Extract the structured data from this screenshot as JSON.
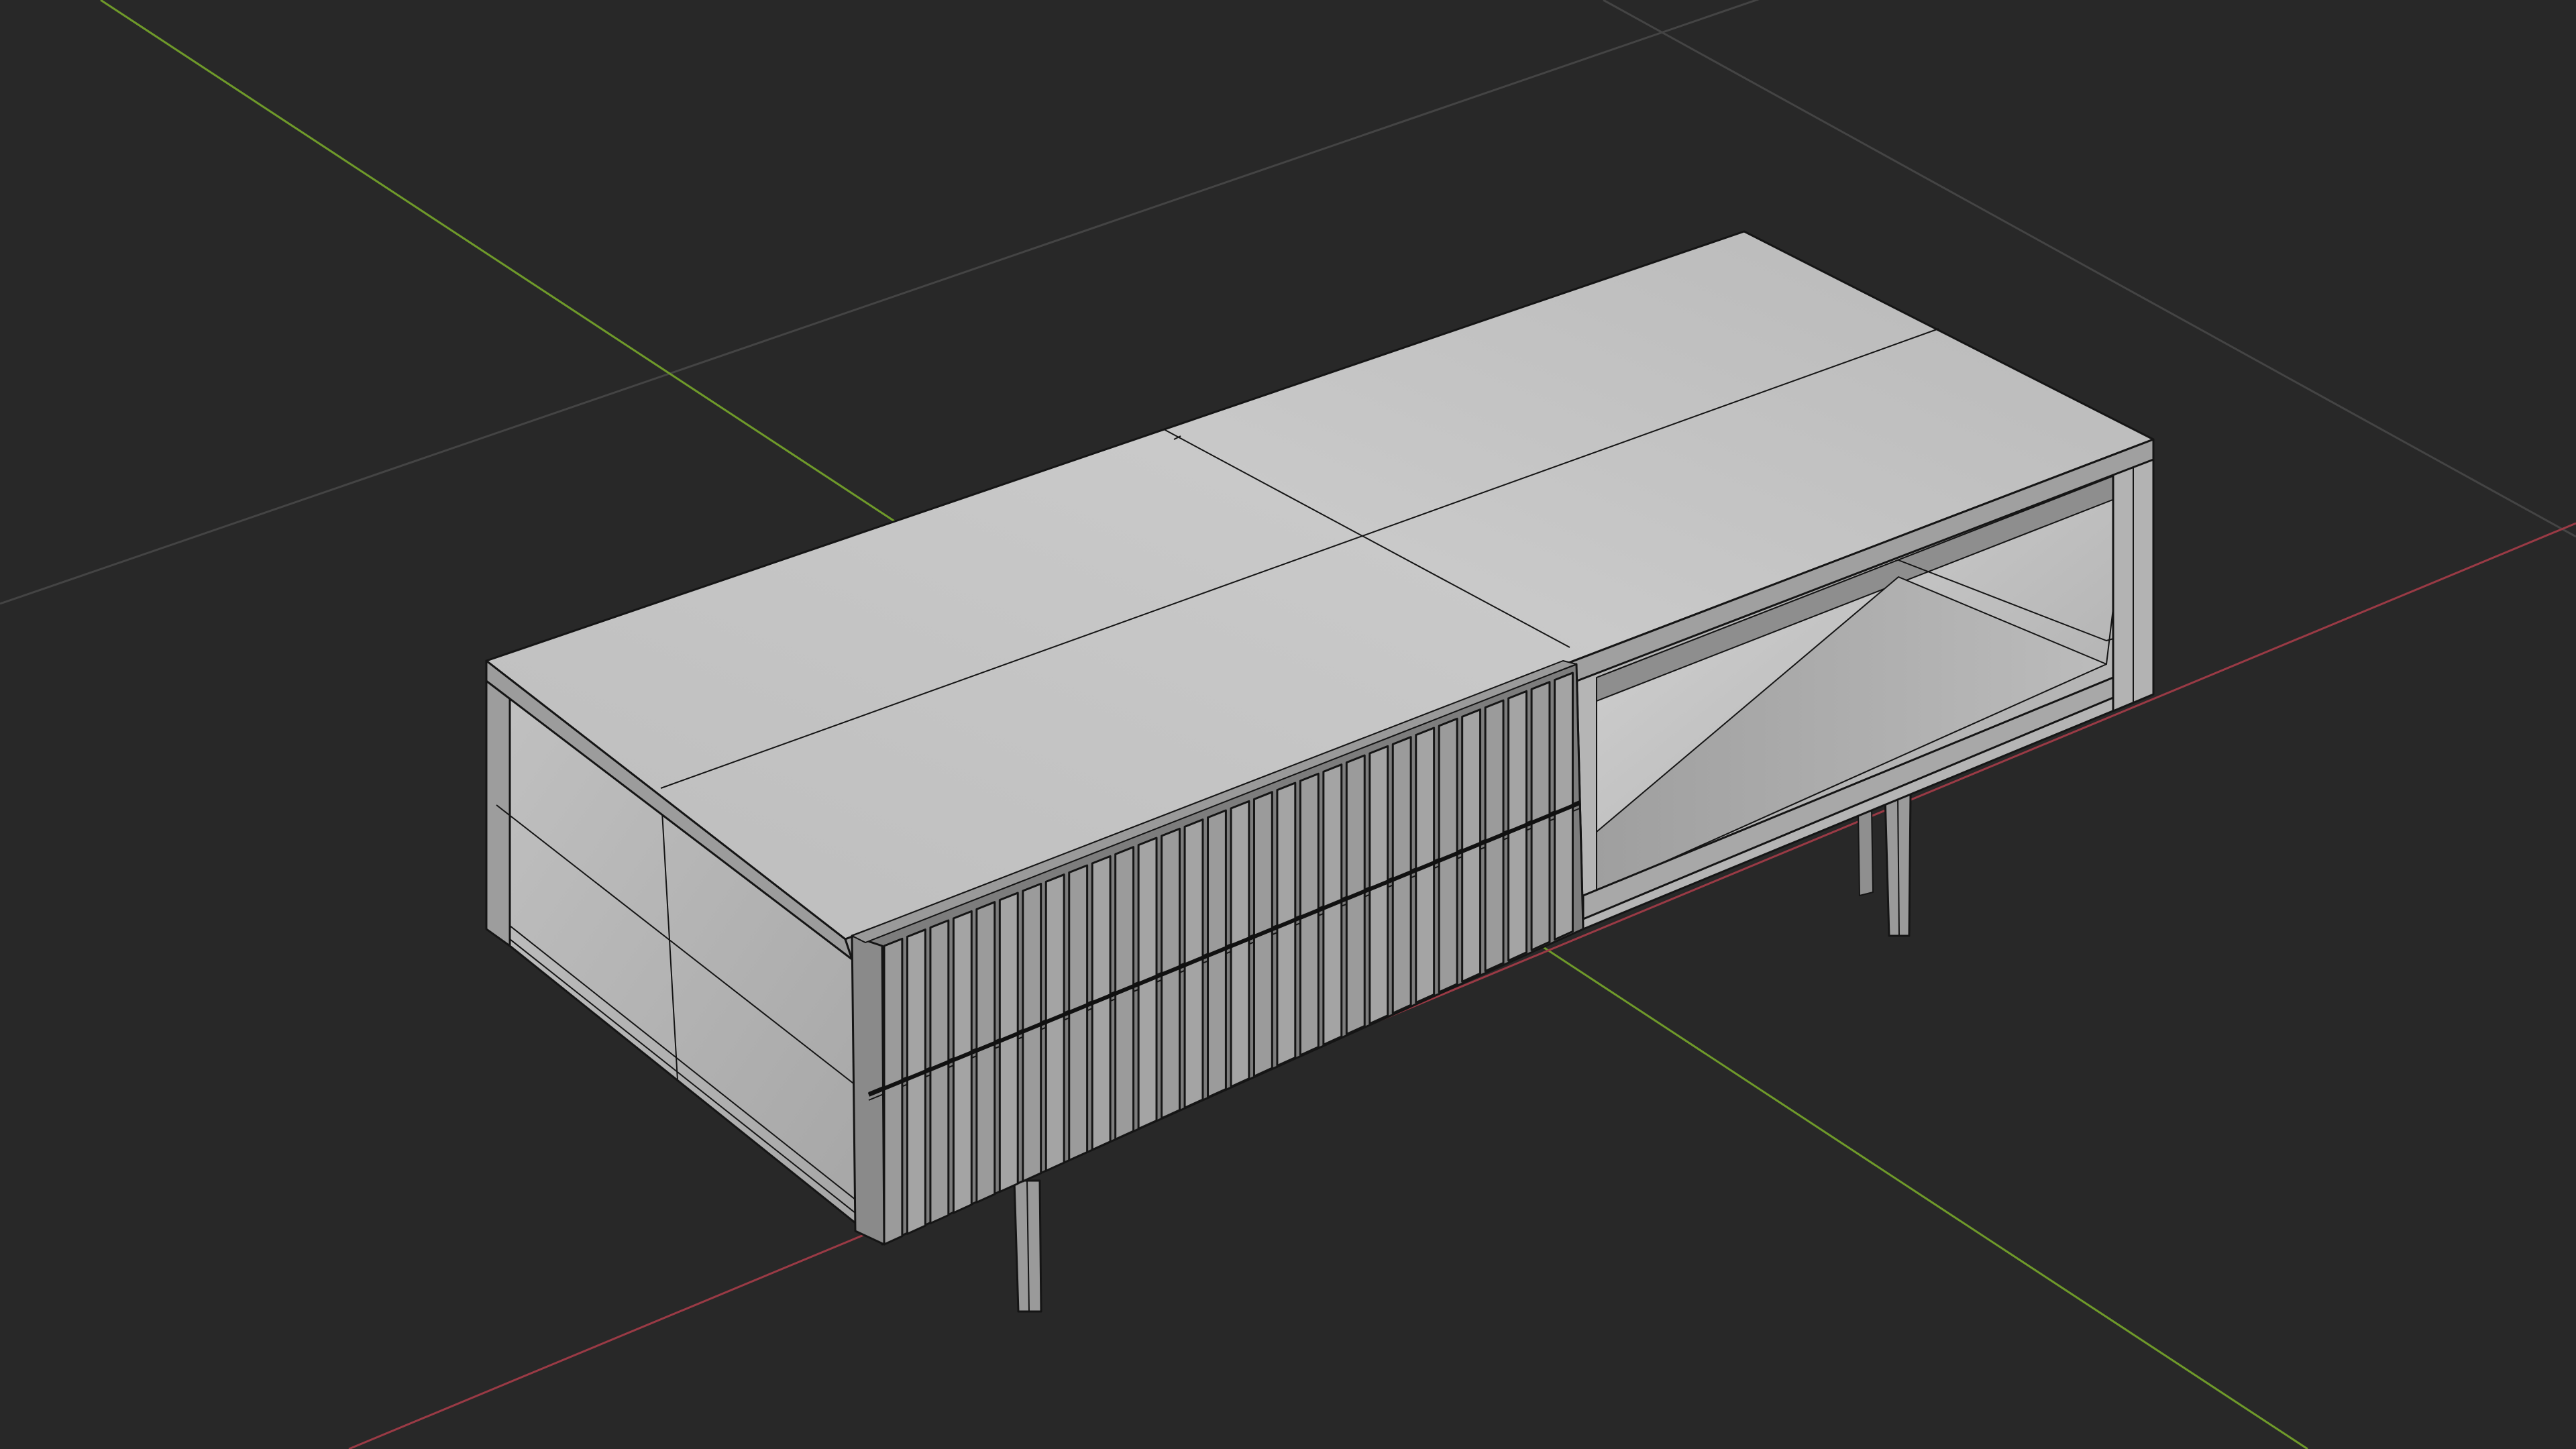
{
  "app": {
    "title": "",
    "view": "3D Viewport",
    "shading": "solid",
    "overlay": "wireframe"
  },
  "colors": {
    "background": "#282828",
    "grid_line": "#3f3f3f",
    "x_axis": "#9a3a45",
    "y_axis": "#6f9a2a",
    "model_light": "#c6c6c6",
    "model_mid": "#a9a9a9",
    "model_dark": "#7b7b7b",
    "wire": "#141414"
  },
  "scene": {
    "object": "tv-stand",
    "has_fluted_drawer_front": true,
    "has_open_shelf": true
  }
}
